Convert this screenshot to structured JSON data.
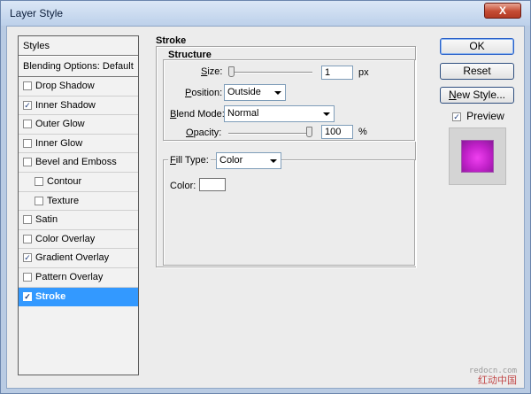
{
  "window": {
    "title": "Layer Style",
    "close_label": "X"
  },
  "styles": {
    "header": "Styles",
    "blending_options": "Blending Options: Default",
    "items": [
      {
        "label": "Drop Shadow",
        "checked": false,
        "sub": false,
        "selected": false
      },
      {
        "label": "Inner Shadow",
        "checked": true,
        "sub": false,
        "selected": false
      },
      {
        "label": "Outer Glow",
        "checked": false,
        "sub": false,
        "selected": false
      },
      {
        "label": "Inner Glow",
        "checked": false,
        "sub": false,
        "selected": false
      },
      {
        "label": "Bevel and Emboss",
        "checked": false,
        "sub": false,
        "selected": false
      },
      {
        "label": "Contour",
        "checked": false,
        "sub": true,
        "selected": false
      },
      {
        "label": "Texture",
        "checked": false,
        "sub": true,
        "selected": false
      },
      {
        "label": "Satin",
        "checked": false,
        "sub": false,
        "selected": false
      },
      {
        "label": "Color Overlay",
        "checked": false,
        "sub": false,
        "selected": false
      },
      {
        "label": "Gradient Overlay",
        "checked": true,
        "sub": false,
        "selected": false
      },
      {
        "label": "Pattern Overlay",
        "checked": false,
        "sub": false,
        "selected": false
      },
      {
        "label": "Stroke",
        "checked": true,
        "sub": false,
        "selected": true
      }
    ]
  },
  "stroke": {
    "title": "Stroke",
    "structure_title": "Structure",
    "size_label": "Size:",
    "size_value": "1",
    "size_unit": "px",
    "position_label": "Position:",
    "position_value": "Outside",
    "blend_label": "Blend Mode:",
    "blend_value": "Normal",
    "opacity_label": "Opacity:",
    "opacity_value": "100",
    "opacity_unit": "%",
    "size_slider_level": 0.0,
    "opacity_slider_level": 1.0,
    "fill_type_label": "Fill Type:",
    "fill_type_value": "Color",
    "color_label": "Color:",
    "color_value": "#ffffff"
  },
  "buttons": {
    "ok": "OK",
    "reset": "Reset",
    "new_style": "New Style...",
    "preview_label": "Preview",
    "preview_checked": true
  },
  "watermark": {
    "site": "redocn.com",
    "text": "红动中国"
  }
}
